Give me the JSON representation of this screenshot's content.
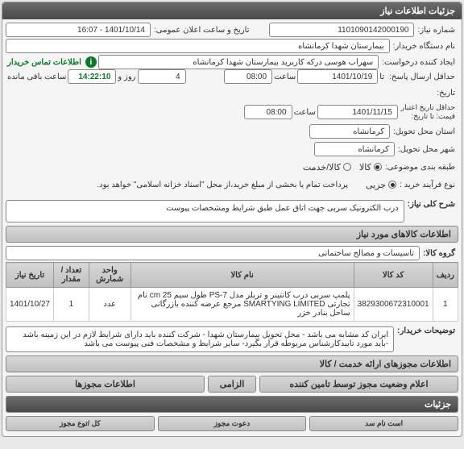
{
  "header": {
    "title": "جزئیات اطلاعات نیاز"
  },
  "form": {
    "niaz_no_label": "شماره نیاز:",
    "niaz_no": "1101090142000190",
    "elan_date_label": "تاریخ و ساعت اعلان عمومی:",
    "elan_date": "1401/10/14 - 16:07",
    "buyer_label": "نام دستگاه خریدار:",
    "buyer": "بیمارستان شهدا کرمانشاه",
    "requester_label": "ایجاد کننده درخواست:",
    "requester": "سهراب هوسی درکه کاربرید بیمارستان شهدا کرمانشاه",
    "contact_label": "اطلاعات تماس خریدار",
    "send_deadline_label": "حداقل ارسال پاسخ:",
    "ta_label": "تا",
    "send_date": "1401/10/19",
    "saat_label": "ساعت",
    "send_time": "08:00",
    "rooz_label": "روز و",
    "rooz": "4",
    "remaining_label": "ساعت باقی مانده",
    "remaining": "14:22:10",
    "tarikh_label": "تاریخ:",
    "az_tarikh_label": "حداقل تاریخ اعتبار",
    "ta_tarikh_label": "قیمت: تا تاریخ:",
    "valid_date": "1401/11/15",
    "valid_time": "08:00",
    "state_label": "استان محل تحویل:",
    "state": "کرمانشاه",
    "city_label": "شهر محل تحویل:",
    "city": "کرمانشاه",
    "class_label": "طبقه بندی موضوعی:",
    "kala": "کالا",
    "khedmat": "کالا/خدمت",
    "buy_type_label": "نوع فرآیند خرید :",
    "jozi": "جزیی",
    "payment_note": "پرداخت تمام یا بخشی از مبلغ خرید،از محل \"اسناد خزانه اسلامی\" خواهد بود."
  },
  "desc": {
    "label": "شرح کلی نیاز:",
    "text": "درب الکترونیک سربی جهت اتاق عمل طبق شرایط ومشخصات پیوست"
  },
  "kala_section": {
    "title": "اطلاعات کالاهای مورد نیاز",
    "group_label": "گروه کالا:",
    "group": "تاسیسات و مصالح ساختمانی"
  },
  "table": {
    "headers": {
      "radif": "ردیف",
      "code": "کد کالا",
      "name": "نام کالا",
      "unit": "واحد شمارش",
      "qty": "تعداد / مقدار",
      "date": "تاریخ نیاز"
    },
    "row": {
      "radif": "1",
      "code": "3829300672310001",
      "name": "پلمپ سربی درب کانتینر و تریلر مدل PS-7 طول سیم cm 25 نام تجارتی SMARTYING LIMITED مرجع عرضه کننده بازرگانی ساحل بنادر خزر",
      "unit": "عدد",
      "qty": "1",
      "date": "1401/10/27"
    }
  },
  "notes": {
    "label": "توضیحات خریدار:",
    "text": "ایران کد مشابه می باشد - محل تحویل بیمارستان شهدا - شرکت کننده باید دارای شرایط لازم در این زمینه باشد -باید مورد تاییدکارشناس مربوطه قرار بگیرد- سایر شرایط و مشخصات فنی پیوست می باشد"
  },
  "sub1": {
    "title": "اطلاعات مجوزهای ارائه خدمت / کالا"
  },
  "sub2": {
    "title": "اعلام وضعیت مجوز توسط تامین کننده"
  },
  "cols": {
    "c1": "الزامی",
    "c2": "اطلاعات مجوزها"
  },
  "footer": {
    "title": "جزئیات",
    "c1": "كل /توع مجوز",
    "c2": "دعوت مجوز",
    "c3": "است نام سد"
  }
}
